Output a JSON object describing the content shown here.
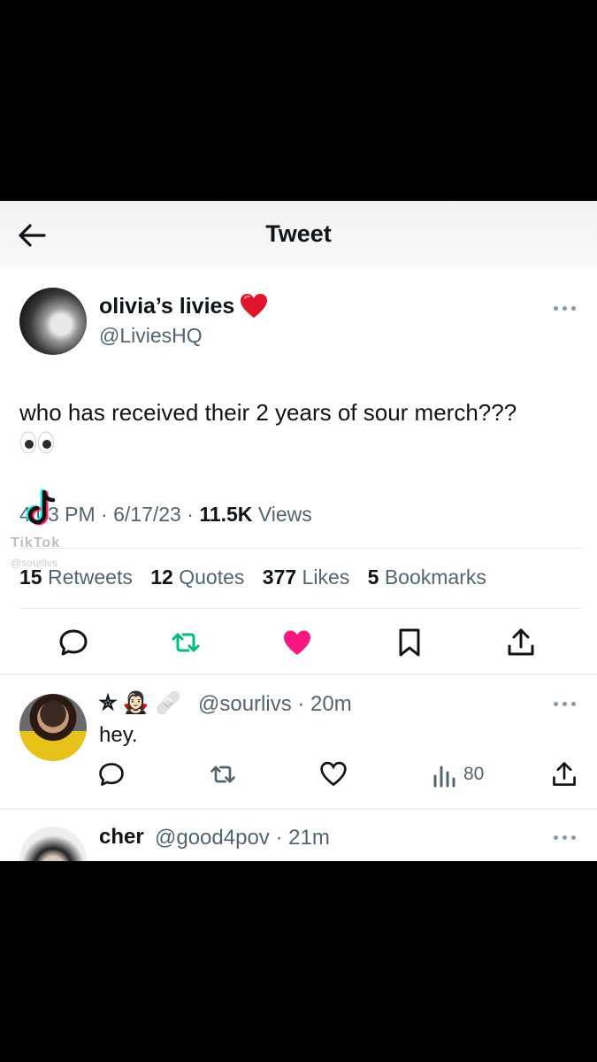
{
  "header": {
    "title": "Tweet"
  },
  "tweet": {
    "author_name": "olivia’s livies",
    "author_handle": "@LiviesHQ",
    "text": "who has received their 2 years of sour merch???",
    "time": "4:03 PM",
    "date": "6/17/23",
    "views_count": "11.5K",
    "views_label": "Views",
    "watermark": "TikTok",
    "watermark_user": "@sourlivs",
    "stats": {
      "retweets_count": "15",
      "retweets_label": "Retweets",
      "quotes_count": "12",
      "quotes_label": "Quotes",
      "likes_count": "377",
      "likes_label": "Likes",
      "bookmarks_count": "5",
      "bookmarks_label": "Bookmarks"
    },
    "liked": true,
    "colors": {
      "like": "#f91880",
      "retweet": "#00ba7c",
      "text": "#0f1419",
      "secondary": "#536471"
    }
  },
  "replies": [
    {
      "name_emojis": "✮ 🧛🏻‍♀️ 🩹",
      "handle": "@sourlivs",
      "time": "20m",
      "text": "hey.",
      "views": "80"
    },
    {
      "name": "cher",
      "handle": "@good4pov",
      "time": "21m"
    }
  ],
  "icons": [
    "back-arrow-icon",
    "more-icon",
    "reply-icon",
    "retweet-icon",
    "like-icon",
    "bookmark-icon",
    "share-icon",
    "views-icon",
    "tiktok-logo-icon"
  ]
}
